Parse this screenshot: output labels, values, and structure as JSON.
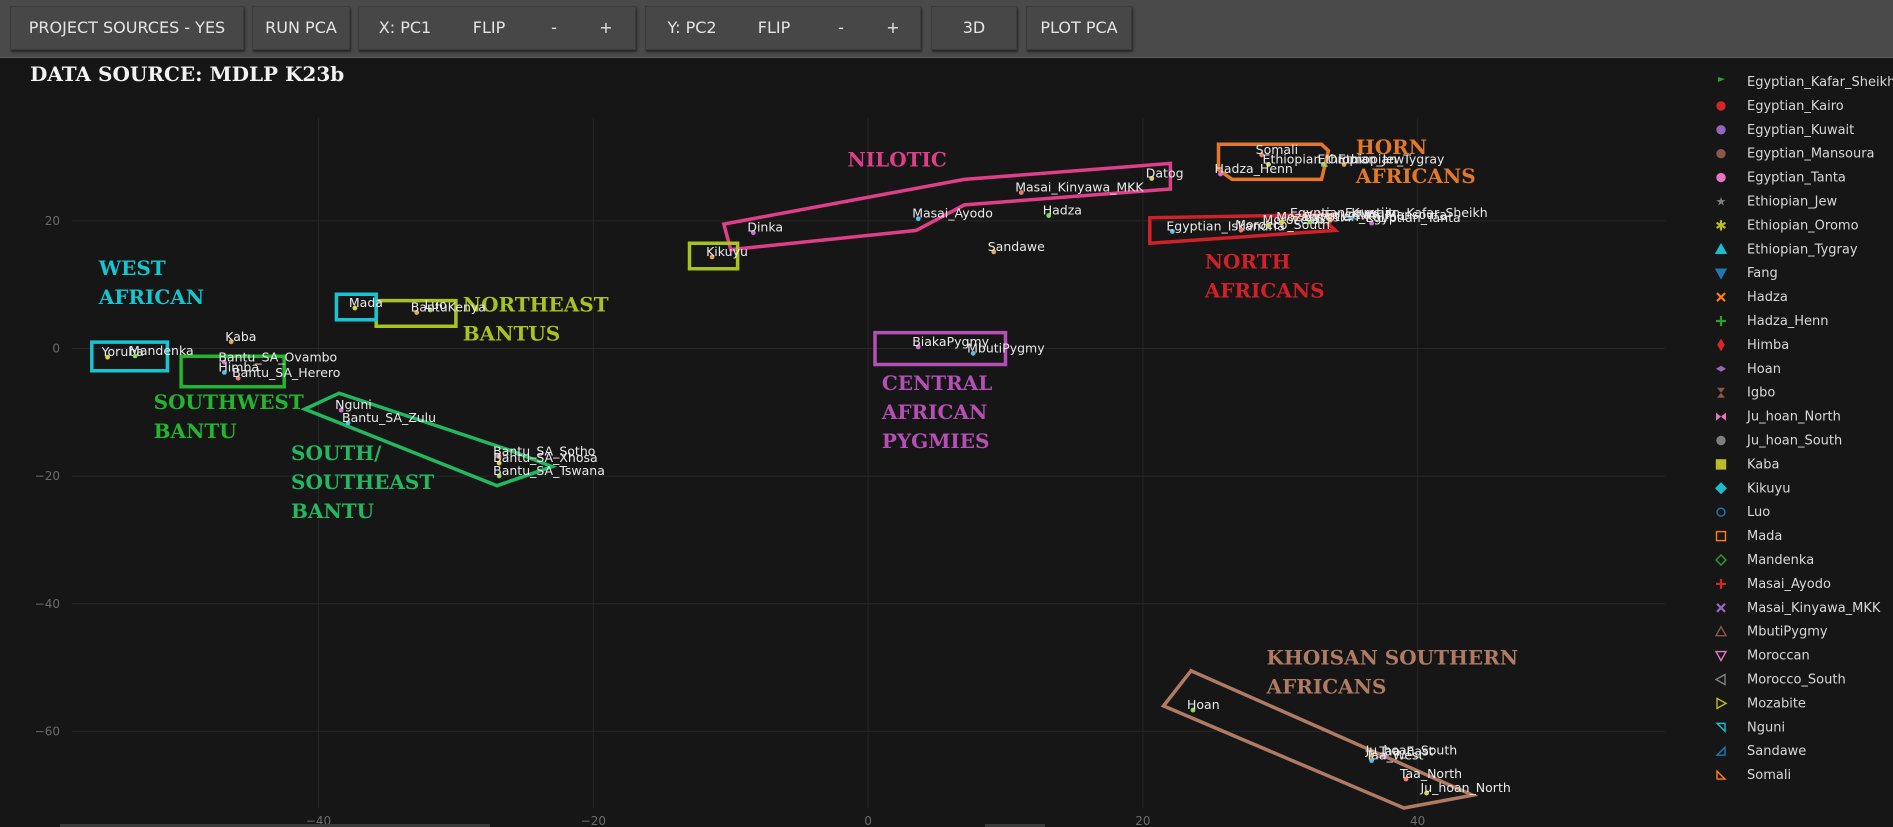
{
  "toolbar": {
    "project_sources": "PROJECT SOURCES - YES",
    "run_pca": "RUN PCA",
    "x_label": "X: PC1",
    "x_flip": "FLIP",
    "x_minus": "-",
    "x_plus": "+",
    "y_label": "Y: PC2",
    "y_flip": "FLIP",
    "y_minus": "-",
    "y_plus": "+",
    "three_d": "3D",
    "plot_pca": "PLOT PCA"
  },
  "chart_data": {
    "type": "scatter",
    "title": "DATA SOURCE: MDLP K23b",
    "xlabel": "",
    "ylabel": "",
    "xlim": [
      -61,
      58
    ],
    "ylim": [
      -72,
      38
    ],
    "x_ticks": [
      -40,
      -20,
      0,
      20,
      40
    ],
    "y_ticks": [
      20,
      0,
      -20,
      -40,
      -60
    ],
    "grid": true,
    "legend_position": "right",
    "points": [
      {
        "name": "Yoruba",
        "x": -55.5,
        "y": -1.2
      },
      {
        "name": "Mandenka",
        "x": -53.5,
        "y": -1.0
      },
      {
        "name": "Kaba",
        "x": -46.5,
        "y": 1.2
      },
      {
        "name": "Bantu_SA_Ovambo",
        "x": -47,
        "y": -2.0
      },
      {
        "name": "Himba",
        "x": -47,
        "y": -3.6
      },
      {
        "name": "Bantu_SA_Herero",
        "x": -46,
        "y": -4.5
      },
      {
        "name": "Mada",
        "x": -37.5,
        "y": 6.5
      },
      {
        "name": "Luo",
        "x": -32,
        "y": 6.2
      },
      {
        "name": "BantuKenya",
        "x": -33,
        "y": 5.8
      },
      {
        "name": "Nguni",
        "x": -38.5,
        "y": -9.5
      },
      {
        "name": "Bantu_SA_Zulu",
        "x": -38,
        "y": -11.5
      },
      {
        "name": "Bantu_SA_Sotho",
        "x": -27,
        "y": -16.8
      },
      {
        "name": "Bantu_SA_Xhosa",
        "x": -27,
        "y": -17.8
      },
      {
        "name": "Bantu_SA_Tswana",
        "x": -27,
        "y": -19.8
      },
      {
        "name": "Kikuyu",
        "x": -11.5,
        "y": 14.5
      },
      {
        "name": "Dinka",
        "x": -8.5,
        "y": 18.3
      },
      {
        "name": "Masai_Ayodo",
        "x": 3.5,
        "y": 20.5
      },
      {
        "name": "Masai_Kinyawa_MKK",
        "x": 11,
        "y": 24.6
      },
      {
        "name": "Datog",
        "x": 20.5,
        "y": 26.8
      },
      {
        "name": "Hadza",
        "x": 13,
        "y": 21
      },
      {
        "name": "Sandawe",
        "x": 9,
        "y": 15.3
      },
      {
        "name": "BiakaPygmy",
        "x": 3.5,
        "y": 0.4
      },
      {
        "name": "MbutiPygmy",
        "x": 7.5,
        "y": -0.6
      },
      {
        "name": "Somali",
        "x": 28.5,
        "y": 30.5
      },
      {
        "name": "Ethiopian_Oromo",
        "x": 29,
        "y": 29
      },
      {
        "name": "Ethiopian_Jew",
        "x": 33,
        "y": 29
      },
      {
        "name": "Ethiopian_Tygray",
        "x": 34.5,
        "y": 29
      },
      {
        "name": "Hadza_Henn",
        "x": 25.5,
        "y": 27.5
      },
      {
        "name": "Egyptian_Iskandria",
        "x": 22,
        "y": 18.5
      },
      {
        "name": "Morocco_South",
        "x": 27,
        "y": 18.7
      },
      {
        "name": "Moroccan",
        "x": 29,
        "y": 19.5
      },
      {
        "name": "Egyptian_Kairo",
        "x": 32,
        "y": 20
      },
      {
        "name": "Egyptian_Mansoura",
        "x": 33.5,
        "y": 20.3
      },
      {
        "name": "Egyptian_Tanta",
        "x": 36.5,
        "y": 19.8
      },
      {
        "name": "Egyptian_Kafar_Sheikh",
        "x": 35,
        "y": 20.6
      },
      {
        "name": "Egyptian_Kuwait",
        "x": 31,
        "y": 20.6
      },
      {
        "name": "Mozabite",
        "x": 30,
        "y": 20
      },
      {
        "name": "Hoan",
        "x": 23.5,
        "y": -56.5
      },
      {
        "name": "Ju_hoan_South",
        "x": 36.5,
        "y": -63.6
      },
      {
        "name": "Taa_East",
        "x": 37.5,
        "y": -63.8
      },
      {
        "name": "Taa_West",
        "x": 36.5,
        "y": -64.4
      },
      {
        "name": "Taa_North",
        "x": 39,
        "y": -67.3
      },
      {
        "name": "Ju_hoan_North",
        "x": 40.5,
        "y": -69.5
      }
    ],
    "groups": [
      {
        "name": "WEST\nAFRICAN",
        "color": "#17c4cf"
      },
      {
        "name": "SOUTHWEST\nBANTU",
        "color": "#22b52e"
      },
      {
        "name": "NORTHEAST\nBANTUS",
        "color": "#a6c31f"
      },
      {
        "name": "SOUTH/\nSOUTHEAST\nBANTU",
        "color": "#22b860"
      },
      {
        "name": "NILOTIC",
        "color": "#de3f8a"
      },
      {
        "name": "HORN\nAFRICANS",
        "color": "#e4782a"
      },
      {
        "name": "NORTH\nAFRICANS",
        "color": "#cf2127"
      },
      {
        "name": "CENTRAL\nAFRICAN\nPYGMIES",
        "color": "#b44fb6"
      },
      {
        "name": "KHOISAN SOUTHERN\nAFRICANS",
        "color": "#b07b62"
      },
      {
        "name": "",
        "color": "#17c4cf"
      }
    ],
    "legend": [
      {
        "label": "Egyptian_Kafar_Sheikh",
        "symbol": "flag",
        "color": "#2ca02c"
      },
      {
        "label": "Egyptian_Kairo",
        "symbol": "circle",
        "color": "#d62728"
      },
      {
        "label": "Egyptian_Kuwait",
        "symbol": "circle",
        "color": "#9467bd"
      },
      {
        "label": "Egyptian_Mansoura",
        "symbol": "circle",
        "color": "#8c564b"
      },
      {
        "label": "Egyptian_Tanta",
        "symbol": "circle",
        "color": "#e377c2"
      },
      {
        "label": "Ethiopian_Jew",
        "symbol": "star",
        "color": "#7f7f7f"
      },
      {
        "label": "Ethiopian_Oromo",
        "symbol": "asterisk",
        "color": "#bcbd22"
      },
      {
        "label": "Ethiopian_Tygray",
        "symbol": "triangle-up",
        "color": "#17becf"
      },
      {
        "label": "Fang",
        "symbol": "triangle-down",
        "color": "#1f77b4"
      },
      {
        "label": "Hadza",
        "symbol": "x",
        "color": "#ff7f0e"
      },
      {
        "label": "Hadza_Henn",
        "symbol": "cross",
        "color": "#2ca02c"
      },
      {
        "label": "Himba",
        "symbol": "thin-diamond",
        "color": "#d62728"
      },
      {
        "label": "Hoan",
        "symbol": "left-arrow",
        "color": "#9467bd"
      },
      {
        "label": "Igbo",
        "symbol": "hourglass",
        "color": "#8c564b"
      },
      {
        "label": "Ju_hoan_North",
        "symbol": "bowtie",
        "color": "#e377c2"
      },
      {
        "label": "Ju_hoan_South",
        "symbol": "circle",
        "color": "#7f7f7f"
      },
      {
        "label": "Kaba",
        "symbol": "square",
        "color": "#bcbd22"
      },
      {
        "label": "Kikuyu",
        "symbol": "diamond",
        "color": "#17becf"
      },
      {
        "label": "Luo",
        "symbol": "circle-open",
        "color": "#1f77b4"
      },
      {
        "label": "Mada",
        "symbol": "square-open",
        "color": "#ff7f0e"
      },
      {
        "label": "Mandenka",
        "symbol": "diamond-open",
        "color": "#2ca02c"
      },
      {
        "label": "Masai_Ayodo",
        "symbol": "cross-open",
        "color": "#d62728"
      },
      {
        "label": "Masai_Kinyawa_MKK",
        "symbol": "x-open",
        "color": "#9467bd"
      },
      {
        "label": "MbutiPygmy",
        "symbol": "triangle-up-open",
        "color": "#8c564b"
      },
      {
        "label": "Moroccan",
        "symbol": "triangle-down-open",
        "color": "#e377c2"
      },
      {
        "label": "Morocco_South",
        "symbol": "triangle-left-open",
        "color": "#7f7f7f"
      },
      {
        "label": "Mozabite",
        "symbol": "triangle-right-open",
        "color": "#bcbd22"
      },
      {
        "label": "Nguni",
        "symbol": "triangle-ne-open",
        "color": "#17becf"
      },
      {
        "label": "Sandawe",
        "symbol": "triangle-se",
        "color": "#1f77b4"
      },
      {
        "label": "Somali",
        "symbol": "triangle-sw",
        "color": "#ff7f0e"
      }
    ]
  }
}
